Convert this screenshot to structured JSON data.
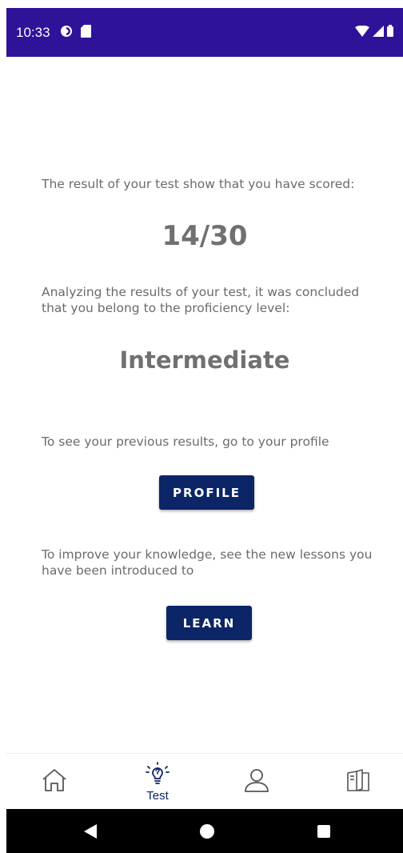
{
  "status_bar": {
    "time": "10:33",
    "icons_left": [
      "data-saver-icon",
      "sd-card-icon"
    ],
    "icons_right": [
      "wifi-icon",
      "signal-icon",
      "battery-icon"
    ],
    "background": "#2e1399"
  },
  "result": {
    "intro_text": "The result of your test show that you have scored:",
    "score": "14/30",
    "analysis_text": "Analyzing the results of your test, it was concluded that you belong to the proficiency level:",
    "level": "Intermediate"
  },
  "profile_section": {
    "text": "To see your previous results, go to your profile",
    "button_label": "PROFILE"
  },
  "learn_section": {
    "text": "To improve your knowledge, see the new lessons you have been introduced to",
    "button_label": "LEARN"
  },
  "colors": {
    "accent": "#0b2566",
    "text": "#6b6b6b"
  },
  "bottom_nav": {
    "items": [
      {
        "icon": "home-icon",
        "label": ""
      },
      {
        "icon": "lightbulb-question-icon",
        "label": "Test",
        "active": true
      },
      {
        "icon": "profile-icon",
        "label": ""
      },
      {
        "icon": "book-icon",
        "label": ""
      }
    ]
  },
  "system_nav": {
    "icons": [
      "back-icon",
      "home-circle-icon",
      "recents-icon"
    ]
  }
}
